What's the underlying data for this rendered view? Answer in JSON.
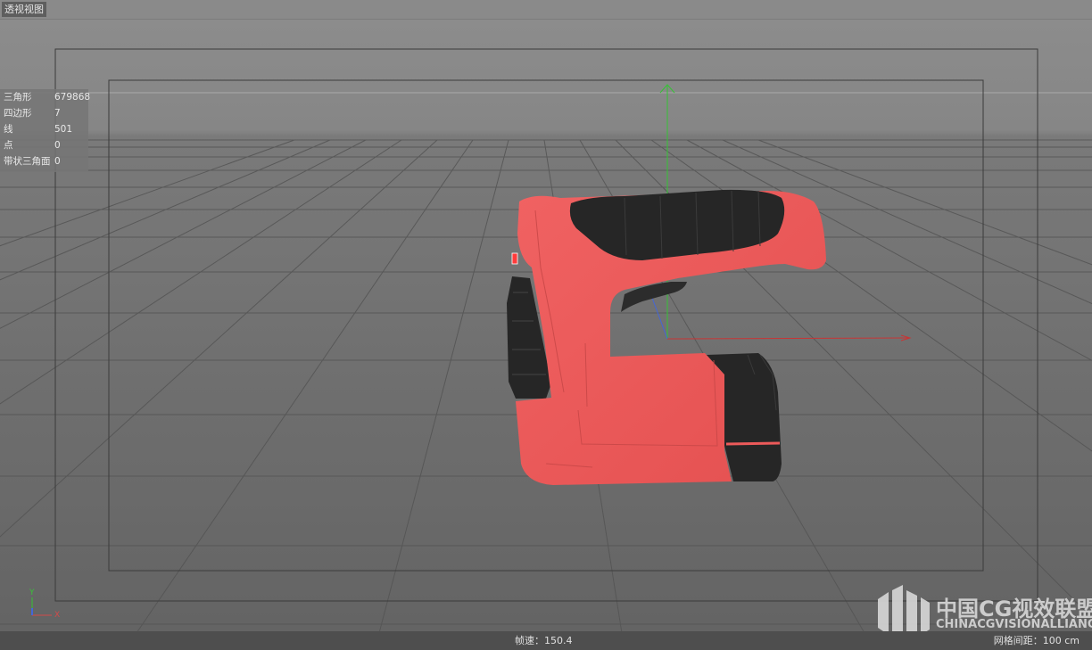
{
  "viewport": {
    "tab_label": "透视视图",
    "model": "cordless-drill"
  },
  "stats": [
    {
      "label": "三角形",
      "value": "679868"
    },
    {
      "label": "四边形",
      "value": "7"
    },
    {
      "label": "线",
      "value": "501"
    },
    {
      "label": "点",
      "value": "0"
    },
    {
      "label": "带状三角面",
      "value": "0"
    }
  ],
  "status_bar": {
    "fps": "帧速：150.4",
    "grid_spacing": "网格间距：100 cm"
  },
  "axes": {
    "y_label": "Y",
    "x_label": "X"
  },
  "watermark": {
    "cn": "中国CG视效联盟",
    "en": "CHINACGVISIONALLIANCE"
  },
  "colors": {
    "body_red": "#ec5a5a",
    "grip_black": "#262626",
    "axis_green": "#35c235",
    "axis_red": "#c83535",
    "axis_blue": "#4466d8"
  }
}
